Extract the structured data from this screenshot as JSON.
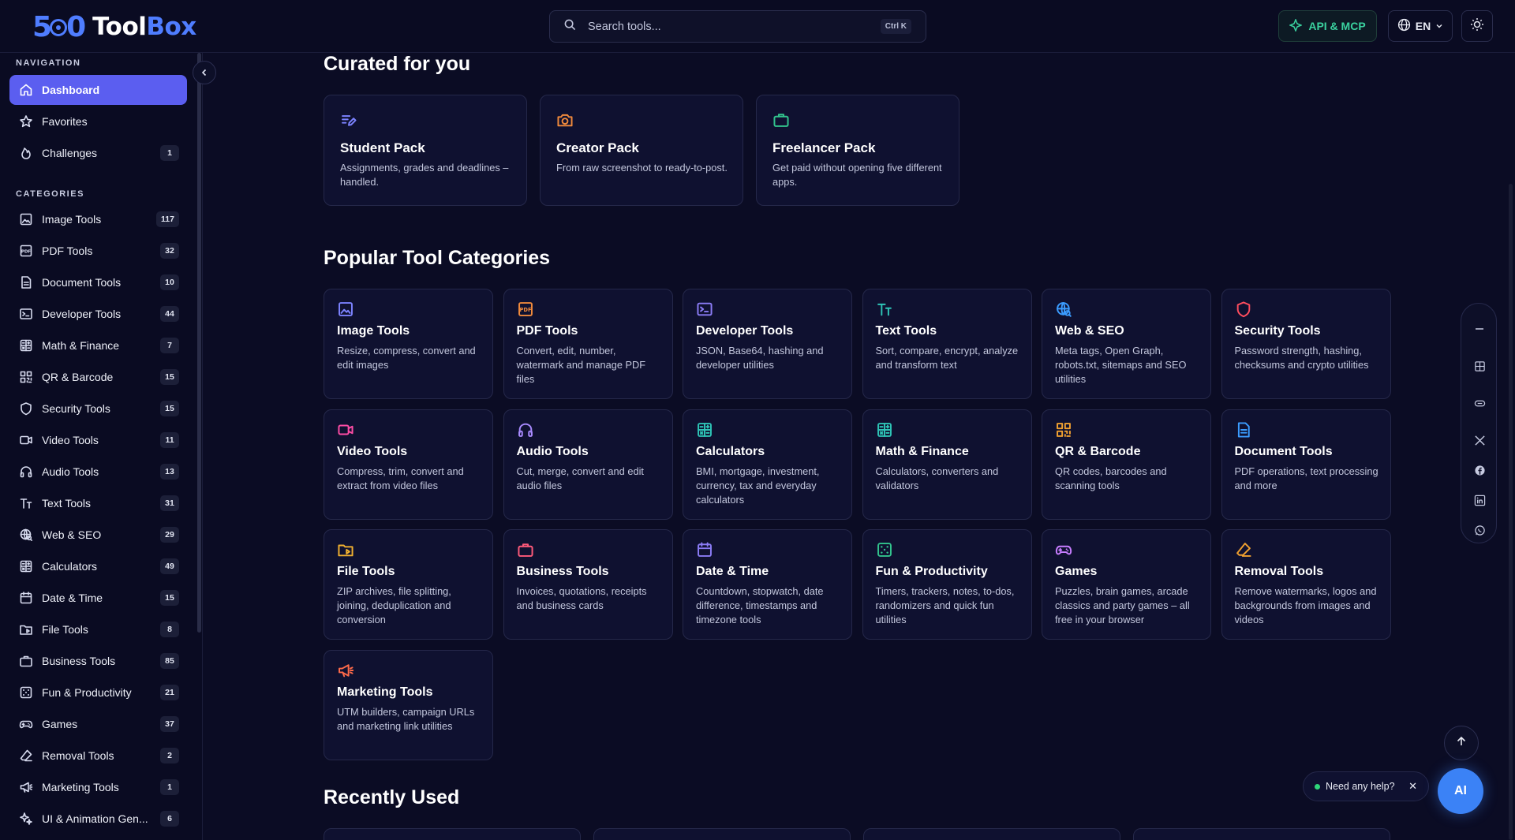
{
  "header": {
    "logo_number_left": "5",
    "logo_number_right": "0",
    "logo_word_1": "Tool",
    "logo_word_2": "Box",
    "search_placeholder": "Search tools...",
    "search_shortcut": "Ctrl K",
    "api_label": "API & MCP",
    "lang_label": "EN"
  },
  "sidebar": {
    "nav_label": "NAVIGATION",
    "nav_items": [
      {
        "label": "Dashboard",
        "badge": "",
        "icon": "home-icon"
      },
      {
        "label": "Favorites",
        "badge": "",
        "icon": "star-icon"
      },
      {
        "label": "Challenges",
        "badge": "1",
        "icon": "flame-icon"
      }
    ],
    "categories_label": "CATEGORIES",
    "categories": [
      {
        "label": "Image Tools",
        "badge": "117",
        "icon": "image-icon"
      },
      {
        "label": "PDF Tools",
        "badge": "32",
        "icon": "pdf-icon"
      },
      {
        "label": "Document Tools",
        "badge": "10",
        "icon": "document-icon"
      },
      {
        "label": "Developer Tools",
        "badge": "44",
        "icon": "terminal-icon"
      },
      {
        "label": "Math & Finance",
        "badge": "7",
        "icon": "calculator-icon"
      },
      {
        "label": "QR & Barcode",
        "badge": "15",
        "icon": "qr-icon"
      },
      {
        "label": "Security Tools",
        "badge": "15",
        "icon": "shield-icon"
      },
      {
        "label": "Video Tools",
        "badge": "11",
        "icon": "video-icon"
      },
      {
        "label": "Audio Tools",
        "badge": "13",
        "icon": "headphones-icon"
      },
      {
        "label": "Text Tools",
        "badge": "31",
        "icon": "text-icon"
      },
      {
        "label": "Web & SEO",
        "badge": "29",
        "icon": "globe-search-icon"
      },
      {
        "label": "Calculators",
        "badge": "49",
        "icon": "calculator-icon"
      },
      {
        "label": "Date & Time",
        "badge": "15",
        "icon": "calendar-icon"
      },
      {
        "label": "File Tools",
        "badge": "8",
        "icon": "folder-icon"
      },
      {
        "label": "Business Tools",
        "badge": "85",
        "icon": "briefcase-icon"
      },
      {
        "label": "Fun & Productivity",
        "badge": "21",
        "icon": "dice-icon"
      },
      {
        "label": "Games",
        "badge": "37",
        "icon": "gamepad-icon"
      },
      {
        "label": "Removal Tools",
        "badge": "2",
        "icon": "eraser-icon"
      },
      {
        "label": "Marketing Tools",
        "badge": "1",
        "icon": "megaphone-icon"
      },
      {
        "label": "UI & Animation Gen...",
        "badge": "6",
        "icon": "sparkle-icon"
      }
    ]
  },
  "curated": {
    "title": "Curated for you",
    "packs": [
      {
        "title": "Student Pack",
        "desc": "Assignments, grades and deadlines – handled.",
        "icon": "pen-list-icon",
        "color": "#7c83ff"
      },
      {
        "title": "Creator Pack",
        "desc": "From raw screenshot to ready-to-post.",
        "icon": "camera-icon",
        "color": "#f08a3c"
      },
      {
        "title": "Freelancer Pack",
        "desc": "Get paid without opening five different apps.",
        "icon": "briefcase-icon",
        "color": "#32c48d"
      }
    ]
  },
  "popular": {
    "title": "Popular Tool Categories",
    "cards": [
      {
        "title": "Image Tools",
        "desc": "Resize, compress, convert and edit images",
        "icon": "image-icon",
        "color": "#7c83ff"
      },
      {
        "title": "PDF Tools",
        "desc": "Convert, edit, number, watermark and manage PDF files",
        "icon": "pdf-icon",
        "color": "#f08a3c"
      },
      {
        "title": "Developer Tools",
        "desc": "JSON, Base64, hashing and developer utilities",
        "icon": "terminal-icon",
        "color": "#8b7cf6"
      },
      {
        "title": "Text Tools",
        "desc": "Sort, compare, encrypt, analyze and transform text",
        "icon": "text-icon",
        "color": "#2ec4b6"
      },
      {
        "title": "Web & SEO",
        "desc": "Meta tags, Open Graph, robots.txt, sitemaps and SEO utilities",
        "icon": "globe-search-icon",
        "color": "#3b9cff"
      },
      {
        "title": "Security Tools",
        "desc": "Password strength, hashing, checksums and crypto utilities",
        "icon": "shield-icon",
        "color": "#ff4d5e"
      },
      {
        "title": "Video Tools",
        "desc": "Compress, trim, convert and extract from video files",
        "icon": "video-icon",
        "color": "#ff4da6"
      },
      {
        "title": "Audio Tools",
        "desc": "Cut, merge, convert and edit audio files",
        "icon": "headphones-icon",
        "color": "#a98bff"
      },
      {
        "title": "Calculators",
        "desc": "BMI, mortgage, investment, currency, tax and everyday calculators",
        "icon": "calculator-icon",
        "color": "#2ec4b6"
      },
      {
        "title": "Math & Finance",
        "desc": "Calculators, converters and validators",
        "icon": "calculator-icon",
        "color": "#2ec4b6"
      },
      {
        "title": "QR & Barcode",
        "desc": "QR codes, barcodes and scanning tools",
        "icon": "qr-icon",
        "color": "#f0a030"
      },
      {
        "title": "Document Tools",
        "desc": "PDF operations, text processing and more",
        "icon": "document-icon",
        "color": "#3b9cff"
      },
      {
        "title": "File Tools",
        "desc": "ZIP archives, file splitting, joining, deduplication and conversion",
        "icon": "folder-icon",
        "color": "#f0b030"
      },
      {
        "title": "Business Tools",
        "desc": "Invoices, quotations, receipts and business cards",
        "icon": "briefcase-icon",
        "color": "#ff5a7a"
      },
      {
        "title": "Date & Time",
        "desc": "Countdown, stopwatch, date difference, timestamps and timezone tools",
        "icon": "calendar-icon",
        "color": "#8b7cf6"
      },
      {
        "title": "Fun & Productivity",
        "desc": "Timers, trackers, notes, to-dos, randomizers and quick fun utilities",
        "icon": "dice-icon",
        "color": "#32c48d"
      },
      {
        "title": "Games",
        "desc": "Puzzles, brain games, arcade classics and party games – all free in your browser",
        "icon": "gamepad-icon",
        "color": "#c77dff"
      },
      {
        "title": "Removal Tools",
        "desc": "Remove watermarks, logos and backgrounds from images and videos",
        "icon": "eraser-icon",
        "color": "#f0a030"
      },
      {
        "title": "Marketing Tools",
        "desc": "UTM builders, campaign URLs and marketing link utilities",
        "icon": "megaphone-icon",
        "color": "#ff6b4a"
      }
    ]
  },
  "recent": {
    "title": "Recently Used"
  },
  "help": {
    "label": "Need any help?",
    "ai_label": "AI"
  },
  "colors": {
    "accent": "#5b5ef0",
    "background": "#0b0c24",
    "api_green": "#3ad29f"
  }
}
